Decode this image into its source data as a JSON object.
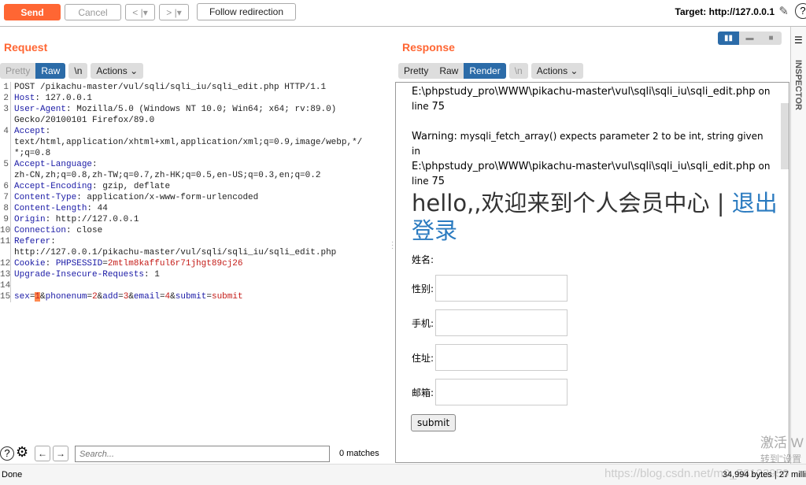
{
  "toolbar": {
    "send": "Send",
    "cancel": "Cancel",
    "back": "<  |▾",
    "forward": ">  |▾",
    "follow": "Follow redirection",
    "target": "Target: http://127.0.0.1"
  },
  "request": {
    "title": "Request",
    "tabs": [
      "Pretty",
      "Raw",
      "\\n"
    ],
    "active_tab": "Raw",
    "actions": "Actions",
    "lines": [
      [
        [
          "POST /pikachu-master/vul/sqli/sqli_iu/sqli_edit.php HTTP/1.1",
          "v"
        ]
      ],
      [
        [
          "Host",
          "k"
        ],
        [
          ": 127.0.0.1",
          "v"
        ]
      ],
      [
        [
          "User-Agent",
          "k"
        ],
        [
          ": Mozilla/5.0 (Windows NT 10.0; Win64; x64; rv:89.0)",
          "v"
        ]
      ],
      [
        [
          "Gecko/20100101 Firefox/89.0",
          "v"
        ]
      ],
      [
        [
          "Accept",
          "k"
        ],
        [
          ":",
          "v"
        ]
      ],
      [
        [
          "text/html,application/xhtml+xml,application/xml;q=0.9,image/webp,*/",
          "v"
        ]
      ],
      [
        [
          "*;q=0.8",
          "v"
        ]
      ],
      [
        [
          "Accept-Language",
          "k"
        ],
        [
          ":",
          "v"
        ]
      ],
      [
        [
          "zh-CN,zh;q=0.8,zh-TW;q=0.7,zh-HK;q=0.5,en-US;q=0.3,en;q=0.2",
          "v"
        ]
      ],
      [
        [
          "Accept-Encoding",
          "k"
        ],
        [
          ": gzip, deflate",
          "v"
        ]
      ],
      [
        [
          "Content-Type",
          "k"
        ],
        [
          ": application/x-www-form-urlencoded",
          "v"
        ]
      ],
      [
        [
          "Content-Length",
          "k"
        ],
        [
          ": 44",
          "v"
        ]
      ],
      [
        [
          "Origin",
          "k"
        ],
        [
          ": http://127.0.0.1",
          "v"
        ]
      ],
      [
        [
          "Connection",
          "k"
        ],
        [
          ": close",
          "v"
        ]
      ],
      [
        [
          "Referer",
          "k"
        ],
        [
          ":",
          "v"
        ]
      ],
      [
        [
          "http://127.0.0.1/pikachu-master/vul/sqli/sqli_iu/sqli_edit.php",
          "v"
        ]
      ],
      [
        [
          "Cookie",
          "k"
        ],
        [
          ": ",
          "v"
        ],
        [
          "PHPSESSID",
          "k"
        ],
        [
          "=",
          "v"
        ],
        [
          "2mtlm8kafful6r71jhgt89cj26",
          "r"
        ]
      ],
      [
        [
          "Upgrade-Insecure-Requests",
          "k"
        ],
        [
          ": 1",
          "v"
        ]
      ],
      [],
      [
        [
          "sex",
          "k"
        ],
        [
          "=",
          "v"
        ],
        [
          "1",
          "r cur"
        ],
        [
          "&",
          "v"
        ],
        [
          "phonenum",
          "k"
        ],
        [
          "=",
          "v"
        ],
        [
          "2",
          "r"
        ],
        [
          "&",
          "v"
        ],
        [
          "add",
          "k"
        ],
        [
          "=",
          "v"
        ],
        [
          "3",
          "r"
        ],
        [
          "&",
          "v"
        ],
        [
          "email",
          "k"
        ],
        [
          "=",
          "v"
        ],
        [
          "4",
          "r"
        ],
        [
          "&",
          "v"
        ],
        [
          "submit",
          "k"
        ],
        [
          "=",
          "v"
        ],
        [
          "submit",
          "r"
        ]
      ]
    ],
    "line_numbers": [
      "1",
      "2",
      "3",
      "",
      "4",
      "",
      "",
      "5",
      "",
      "6",
      "7",
      "8",
      "9",
      "10",
      "11",
      "",
      "12",
      "13",
      "14",
      "15"
    ],
    "search_placeholder": "Search...",
    "matches": "0 matches"
  },
  "response": {
    "title": "Response",
    "tabs": [
      "Pretty",
      "Raw",
      "Render",
      "\\n"
    ],
    "active_tab": "Render",
    "actions": "Actions",
    "path1": "E:\\phpstudy_pro\\WWW\\pikachu-master\\vul\\sqli\\sqli_iu\\sqli_edit.php",
    "on": " on",
    "line_word": "line ",
    "line_no": "75",
    "warning_label": "Warning:",
    "warning_text": " mysqli_fetch_array() expects parameter 2 to be int, string given in",
    "path2": "E:\\phpstudy_pro\\WWW\\pikachu-master\\vul\\sqli\\sqli_iu\\sqli_edit.php",
    "heading": "hello,,欢迎来到个人会员中心 | ",
    "logout": "退出登录",
    "name_label": "姓名:",
    "fields": [
      "性别:",
      "手机:",
      "住址:",
      "邮箱:"
    ],
    "submit": "submit"
  },
  "inspector": {
    "label": "INSPECTOR"
  },
  "status": {
    "left": "Done",
    "right": "34,994 bytes | 27 milli"
  },
  "watermark": {
    "line1": "激活 W",
    "line2": "转到\"设置",
    "url": "https://blog.csdn.net/m0_56123950"
  },
  "colors": {
    "accent": "#ff6633",
    "active_tab": "#2b6ba8"
  }
}
